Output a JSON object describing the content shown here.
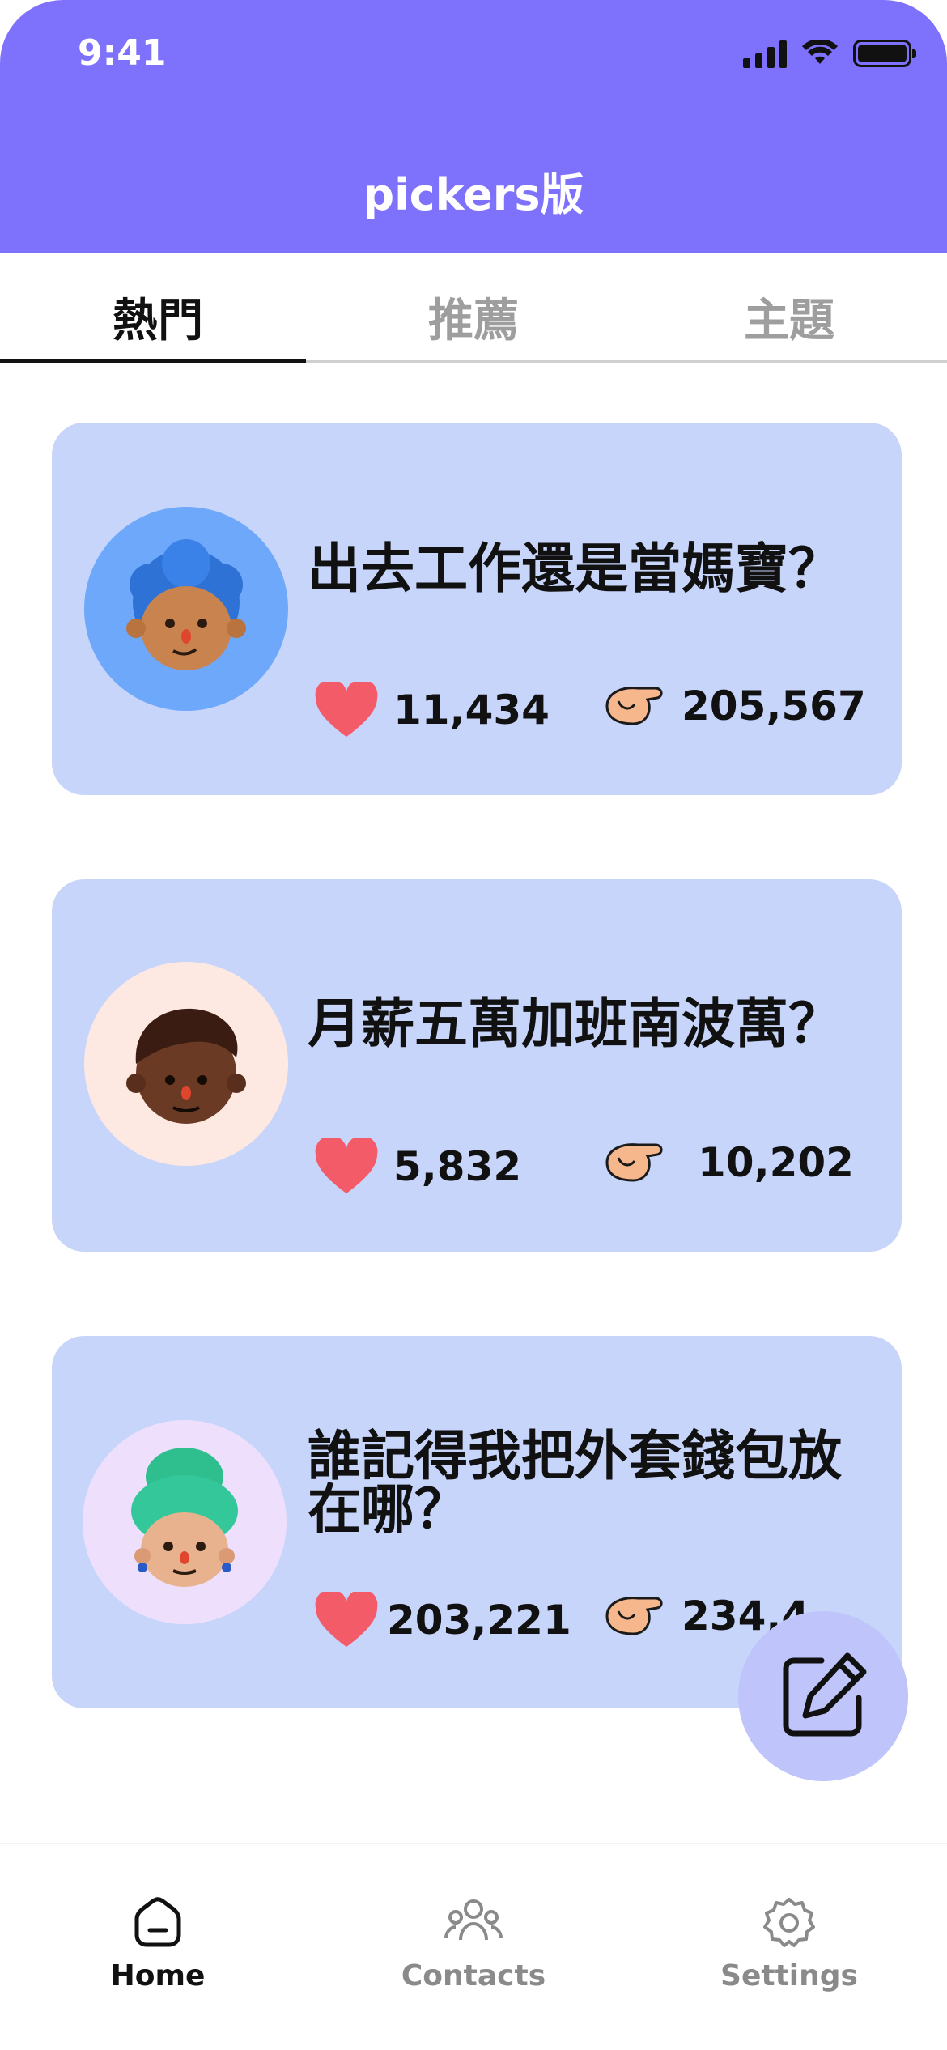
{
  "status": {
    "time": "9:41"
  },
  "header": {
    "title": "pickers版"
  },
  "tabs": [
    {
      "label": "熱門",
      "active": true
    },
    {
      "label": "推薦",
      "active": false
    },
    {
      "label": "主題",
      "active": false
    }
  ],
  "cards": [
    {
      "title": "出去工作還是當媽寶？",
      "likes": "11,434",
      "picks": "205,567",
      "avatar_bg": "#6EA8FB"
    },
    {
      "title": "月薪五萬加班南波萬？",
      "likes": "5,832",
      "picks": "10,202",
      "avatar_bg": "#FDE9E2"
    },
    {
      "title": "誰記得我把外套錢包放在哪？",
      "likes": "203,221",
      "picks": "234,4",
      "avatar_bg": "#EEE0FC"
    }
  ],
  "nav": [
    {
      "label": "Home",
      "icon": "home-icon",
      "active": true
    },
    {
      "label": "Contacts",
      "icon": "contacts-icon",
      "active": false
    },
    {
      "label": "Settings",
      "icon": "settings-icon",
      "active": false
    }
  ],
  "colors": {
    "accent": "#7E72FC",
    "card": "#C8D5FA",
    "heart": "#F45B68",
    "fab": "#BFC4FB"
  }
}
